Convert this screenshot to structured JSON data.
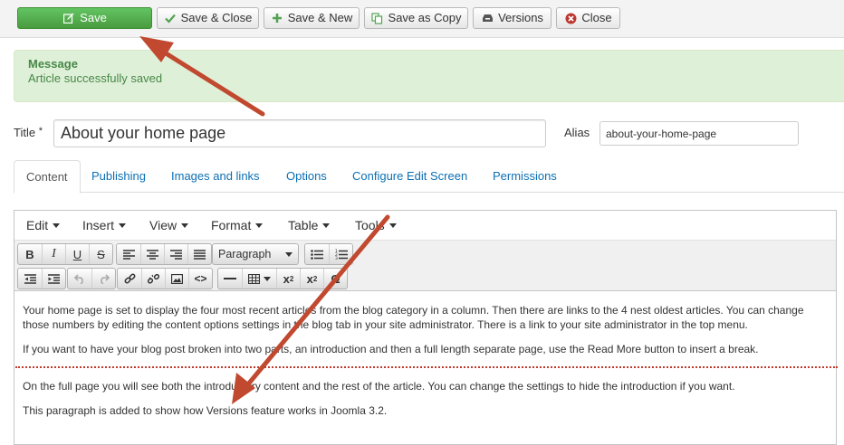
{
  "toolbar": {
    "save": "Save",
    "save_close": "Save & Close",
    "save_new": "Save & New",
    "save_copy": "Save as Copy",
    "versions": "Versions",
    "close": "Close"
  },
  "message": {
    "heading": "Message",
    "text": "Article successfully saved"
  },
  "form": {
    "title_label": "Title",
    "required_mark": "*",
    "title_value": "About your home page",
    "alias_label": "Alias",
    "alias_value": "about-your-home-page"
  },
  "tabs": [
    "Content",
    "Publishing",
    "Images and links",
    "Options",
    "Configure Edit Screen",
    "Permissions"
  ],
  "editor": {
    "menus": [
      "Edit",
      "Insert",
      "View",
      "Format",
      "Table",
      "Tools"
    ],
    "format_select": "Paragraph",
    "paragraphs": [
      "Your home page is set to display the four most recent articles from the blog category in a column. Then there are links to the 4 nest oldest articles. You can change those numbers by editing the content options settings in the blog tab in your site administrator. There is a link to your site administrator in the top menu.",
      "If you want to have your blog post broken into two parts, an introduction and then a full length separate page, use the Read More button to insert a break.",
      "On the full page you will see both the introductory content and the rest of the article. You can change the settings to hide the introduction if you want.",
      "This paragraph is added to show how Versions feature works in Joomla 3.2."
    ]
  },
  "colors": {
    "save_green": "#4a9b3f",
    "message_bg": "#dff0d8",
    "message_text": "#468847",
    "link_blue": "#0d6fb3",
    "arrow_red": "#c0492f",
    "page_break": "#c0392b"
  }
}
